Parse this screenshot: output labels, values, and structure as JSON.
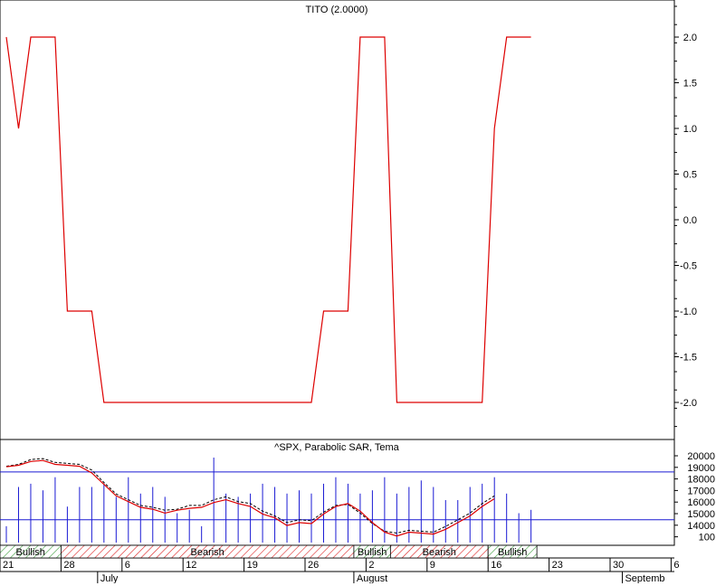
{
  "charts": {
    "top": {
      "title": "TITO (2.0000)",
      "yticks": [
        2.0,
        1.5,
        1.0,
        0.5,
        0.0,
        -0.5,
        -1.0,
        -1.5,
        -2.0
      ],
      "ytick_labels": [
        "2.0",
        "1.5",
        "1.0",
        "0.5",
        "0.0",
        "-0.5",
        "-1.0",
        "-1.5",
        "-2.0"
      ],
      "ylim": [
        -2.4,
        2.5
      ]
    },
    "bottom": {
      "title": "^SPX, Parabolic SAR, Tema",
      "ytick_labels": [
        "20000",
        "19000",
        "18000",
        "17000",
        "16000",
        "15000",
        "14000",
        "100"
      ],
      "y2lines": [
        "20000",
        "15000"
      ]
    },
    "signals": [
      {
        "label": "Bullish",
        "from": 0,
        "to": 5,
        "kind": "bull"
      },
      {
        "label": "Bearish",
        "from": 5,
        "to": 29,
        "kind": "bear"
      },
      {
        "label": "Bullish",
        "from": 29,
        "to": 32,
        "kind": "bull"
      },
      {
        "label": "Bearish",
        "from": 32,
        "to": 40,
        "kind": "bear"
      },
      {
        "label": "Bullish",
        "from": 40,
        "to": 44,
        "kind": "bull"
      }
    ],
    "xaxis": {
      "day_labels": [
        "21",
        "28",
        "6",
        "12",
        "19",
        "26",
        "2",
        "9",
        "16",
        "23",
        "30",
        "6"
      ],
      "day_index": [
        0,
        5,
        10,
        15,
        20,
        25,
        30,
        35,
        40,
        45,
        50,
        55
      ],
      "month_labels": [
        "July",
        "August",
        "Septemb"
      ],
      "month_index": [
        8,
        29,
        51
      ]
    }
  },
  "chart_data": [
    {
      "type": "line",
      "title": "TITO (2.0000)",
      "x_index": [
        0,
        1,
        2,
        3,
        4,
        5,
        6,
        7,
        8,
        9,
        10,
        11,
        12,
        13,
        14,
        15,
        16,
        17,
        18,
        19,
        20,
        21,
        22,
        23,
        24,
        25,
        26,
        27,
        28,
        29,
        30,
        31,
        32,
        33,
        34,
        35,
        36,
        37,
        38,
        39,
        40,
        41,
        42,
        43
      ],
      "series": [
        {
          "values": [
            2,
            1,
            2,
            2,
            2,
            -1,
            -1,
            -1,
            -2,
            -2,
            -2,
            -2,
            -2,
            -2,
            -2,
            -2,
            -2,
            -2,
            -2,
            -2,
            -2,
            -2,
            -2,
            -2,
            -2,
            -2,
            -1,
            -1,
            -1,
            2,
            2,
            2,
            -2,
            -2,
            -2,
            -2,
            -2,
            -2,
            -2,
            -2,
            1,
            2,
            2,
            2
          ],
          "color": "#dd0000"
        }
      ],
      "ylim": [
        -2.4,
        2.5
      ]
    },
    {
      "type": "bar+line",
      "title": "^SPX, Parabolic SAR, Tema",
      "volume_bars": [
        5,
        17,
        18,
        16,
        20,
        11,
        17,
        17,
        18,
        14,
        20,
        15,
        17,
        14,
        9,
        10,
        5,
        26,
        15,
        14,
        15,
        18,
        17,
        15,
        16,
        15,
        18,
        20,
        18,
        15,
        16,
        20,
        15,
        17,
        19,
        17,
        13,
        13,
        17,
        18,
        20,
        15,
        9,
        10
      ],
      "price_line": [
        20550,
        20700,
        21100,
        21200,
        20800,
        20700,
        20600,
        19900,
        18700,
        17500,
        16900,
        16300,
        16100,
        15700,
        16000,
        16200,
        16300,
        16800,
        17100,
        16700,
        16400,
        15600,
        15200,
        14400,
        14700,
        14600,
        15600,
        16400,
        16700,
        15900,
        14700,
        13700,
        13300,
        13700,
        13600,
        13500,
        14000,
        14700,
        15400,
        16400,
        17200
      ],
      "tema_line": [
        20600,
        20800,
        21300,
        21400,
        21000,
        20900,
        20800,
        20200,
        18900,
        17700,
        17100,
        16500,
        16300,
        16000,
        16100,
        16500,
        16500,
        17100,
        17400,
        16900,
        16700,
        15900,
        15400,
        14700,
        15000,
        14900,
        15800,
        16500,
        16600,
        15700,
        14600,
        13800,
        13600,
        13900,
        13800,
        13700,
        14300,
        15000,
        15700,
        16700,
        17500
      ],
      "hlines": [
        20000,
        15000
      ]
    }
  ]
}
